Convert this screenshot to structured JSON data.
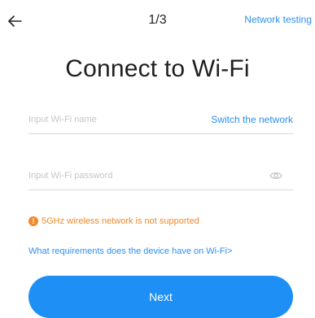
{
  "header": {
    "back_icon": "arrow-left-icon",
    "step_indicator": "1/3",
    "network_testing_label": "Network testing"
  },
  "title": "Connect to Wi-Fi",
  "wifi_name_field": {
    "value": "",
    "placeholder": "Input Wi-Fi name",
    "switch_network_label": "Switch the network"
  },
  "wifi_password_field": {
    "value": "",
    "placeholder": "Input Wi-Fi password",
    "toggle_visibility_icon": "eye-icon"
  },
  "warning": {
    "icon": "exclamation-circle-icon",
    "text": "5GHz wireless network is not supported"
  },
  "requirements_link": "What requirements does the device have on Wi-Fi>",
  "next_button_label": "Next",
  "colors": {
    "accent": "#1e90f5",
    "link": "#2f8ff0",
    "warning": "#f08a2a",
    "text": "#222222",
    "placeholder": "#c6c6c6",
    "divider": "#d9d9d9"
  }
}
